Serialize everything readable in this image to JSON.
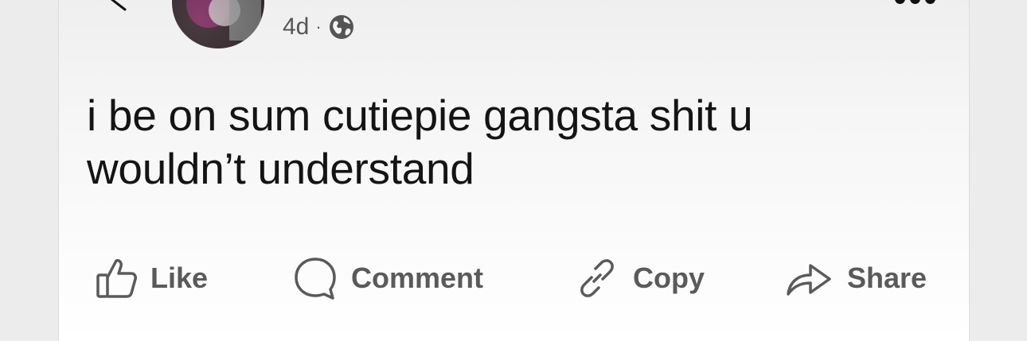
{
  "post": {
    "time": "4d",
    "separator": "·",
    "visibility_icon": "globe-icon",
    "text": "i be on sum cutiepie gangsta shit u\nwouldn’t understand"
  },
  "header": {
    "back_icon": "chevron-left-icon",
    "more_icon": "more-horizontal-icon"
  },
  "actions": [
    {
      "label": "Like",
      "icon": "thumbs-up-icon"
    },
    {
      "label": "Comment",
      "icon": "comment-bubble-icon"
    },
    {
      "label": "Copy",
      "icon": "link-icon"
    },
    {
      "label": "Share",
      "icon": "share-arrow-icon"
    }
  ],
  "colors": {
    "background": "#ececec",
    "card": "#ffffff",
    "text": "#141414",
    "muted": "#5a5a5a"
  }
}
